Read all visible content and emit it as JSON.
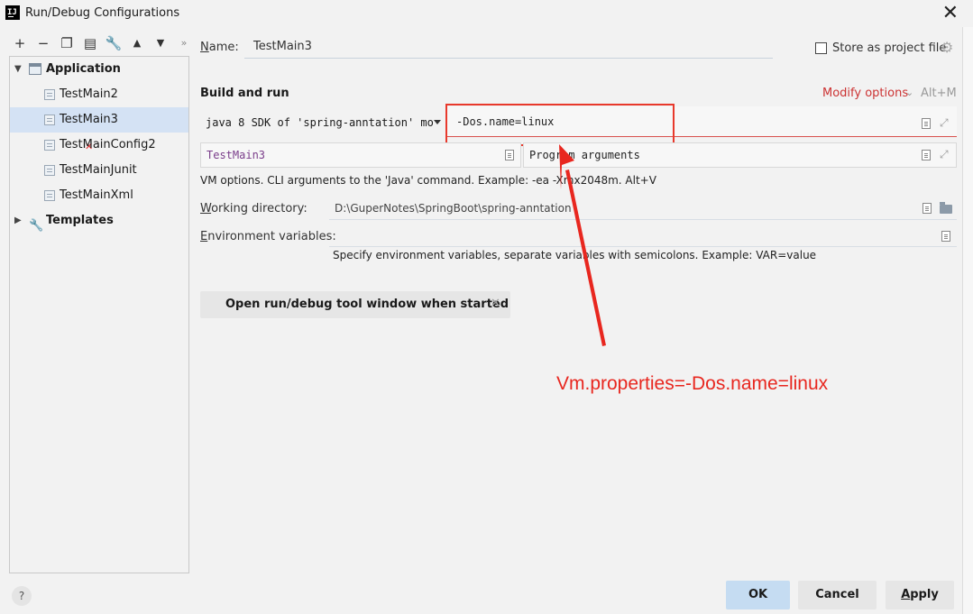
{
  "window": {
    "title": "Run/Debug Configurations",
    "logo_text": "IJ"
  },
  "toolbar": {
    "icons": [
      "add-icon",
      "remove-icon",
      "copy-icon",
      "save-icon",
      "wrench-icon",
      "arrow-up-icon",
      "arrow-down-icon",
      "more-icon"
    ]
  },
  "tree": {
    "group_label": "Application",
    "items": [
      {
        "label": "TestMain2",
        "selected": false,
        "error": false
      },
      {
        "label": "TestMain3",
        "selected": true,
        "error": false
      },
      {
        "label": "TestMainConfig2",
        "selected": false,
        "error": true
      },
      {
        "label": "TestMainJunit",
        "selected": false,
        "error": false
      },
      {
        "label": "TestMainXml",
        "selected": false,
        "error": false
      }
    ],
    "templates_label": "Templates"
  },
  "form": {
    "name_label": "Name:",
    "name_value": "TestMain3",
    "store_label": "Store as project file",
    "store_checked": false,
    "section_title": "Build and run",
    "modify_options": "Modify options",
    "modify_shortcut": "Alt+M",
    "sdk_value": "java 8 SDK of 'spring-anntation' mo",
    "vm_options_value": "-Dos.name=linux",
    "main_class_value": "TestMain3",
    "program_args_placeholder": "Program arguments",
    "vm_hint": "VM options. CLI arguments to the 'Java' command. Example: -ea -Xmx2048m. Alt+V",
    "working_dir_label": "Working directory:",
    "working_dir_value": "D:\\GuperNotes\\SpringBoot\\spring-anntation",
    "env_label": "Environment variables:",
    "env_hint": "Specify environment variables, separate variables with semicolons. Example: VAR=value",
    "chip_label": "Open run/debug tool window when started"
  },
  "annotation": {
    "text": "Vm.properties=-Dos.name=linux",
    "color": "#e8271f"
  },
  "footer": {
    "help": "?",
    "ok": "OK",
    "cancel": "Cancel",
    "apply": "Apply"
  },
  "colors": {
    "selection": "#d4e2f4",
    "accent_red": "#cc3333",
    "ok_button": "#c5dcf2"
  }
}
